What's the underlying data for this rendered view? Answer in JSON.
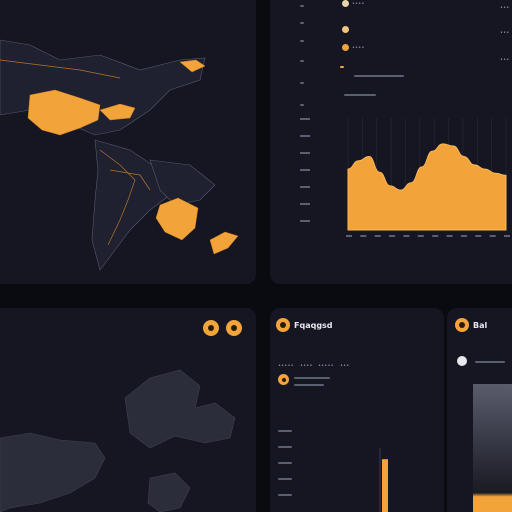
{
  "colors": {
    "accent": "#f2a33a",
    "panel": "#161622",
    "background": "#0a0b10",
    "land_dim": "#2c2d3b"
  },
  "top_right": {
    "legend_values": [
      "••••",
      "••••",
      "••••"
    ],
    "right_markers": [
      "•••",
      "•••",
      "•••"
    ],
    "y_tick_labels": [
      "•••",
      "•••",
      "•••",
      "•••",
      "•••",
      "•••",
      "•••"
    ]
  },
  "stats_panel": {
    "title": "Fqaqgsd",
    "header_icon": "info-icon",
    "subheader_row": [
      "•••••",
      "••••",
      "•••••",
      "•••"
    ]
  },
  "side_panel": {
    "title": "Bal",
    "header_icon": "chart-icon"
  },
  "map_bottom": {
    "icons": [
      "settings-icon",
      "alert-icon"
    ]
  },
  "chart_data": [
    {
      "type": "area",
      "x": [
        0,
        1,
        2,
        3,
        4,
        5,
        6,
        7,
        8,
        9,
        10,
        11,
        12,
        13,
        14,
        15
      ],
      "series": [
        {
          "values": [
            58,
            66,
            70,
            55,
            42,
            38,
            45,
            60,
            75,
            82,
            80,
            70,
            62,
            58,
            54,
            52
          ]
        }
      ],
      "ylim": [
        0,
        100
      ]
    },
    {
      "type": "bar",
      "x": [
        0
      ],
      "series": [
        {
          "values": [
            48
          ]
        }
      ],
      "ylim": [
        0,
        100
      ]
    }
  ]
}
